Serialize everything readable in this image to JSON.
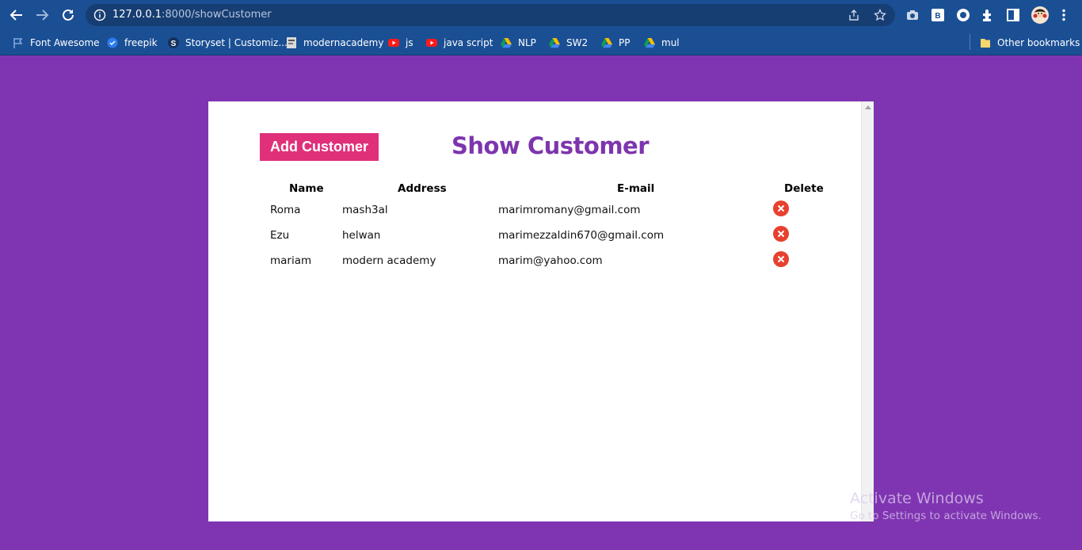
{
  "browser": {
    "url_host": "127.0.0.1",
    "url_rest": ":8000/showCustomer",
    "bookmarks": [
      {
        "label": "Font Awesome",
        "icon": "flag-icon"
      },
      {
        "label": "freepik",
        "icon": "freepik-icon"
      },
      {
        "label": "Storyset | Customiz...",
        "icon": "storyset-icon"
      },
      {
        "label": "modernacademy",
        "icon": "page-icon"
      },
      {
        "label": "js",
        "icon": "youtube-icon"
      },
      {
        "label": "java script",
        "icon": "youtube-icon"
      },
      {
        "label": "NLP",
        "icon": "google-drive-icon"
      },
      {
        "label": "SW2",
        "icon": "google-drive-icon"
      },
      {
        "label": "PP",
        "icon": "google-drive-icon"
      },
      {
        "label": "mul",
        "icon": "google-drive-icon"
      }
    ],
    "other_bookmarks": "Other bookmarks"
  },
  "page": {
    "add_button": "Add Customer",
    "title": "Show Customer",
    "columns": {
      "name": "Name",
      "address": "Address",
      "email": "E-mail",
      "delete": "Delete"
    },
    "rows": [
      {
        "name": "Roma",
        "address": "mash3al",
        "email": "marimromany@gmail.com"
      },
      {
        "name": "Ezu",
        "address": "helwan",
        "email": "marimezzaldin670@gmail.com"
      },
      {
        "name": "mariam",
        "address": "modern academy",
        "email": "marim@yahoo.com"
      }
    ]
  },
  "watermark": {
    "line1": "Activate Windows",
    "line2": "Go to Settings to activate Windows."
  },
  "colors": {
    "background": "#7f35b2",
    "accent_button": "#e0307a",
    "title": "#7d35ad",
    "delete": "#e7402f",
    "chrome": "#1b4f94"
  }
}
